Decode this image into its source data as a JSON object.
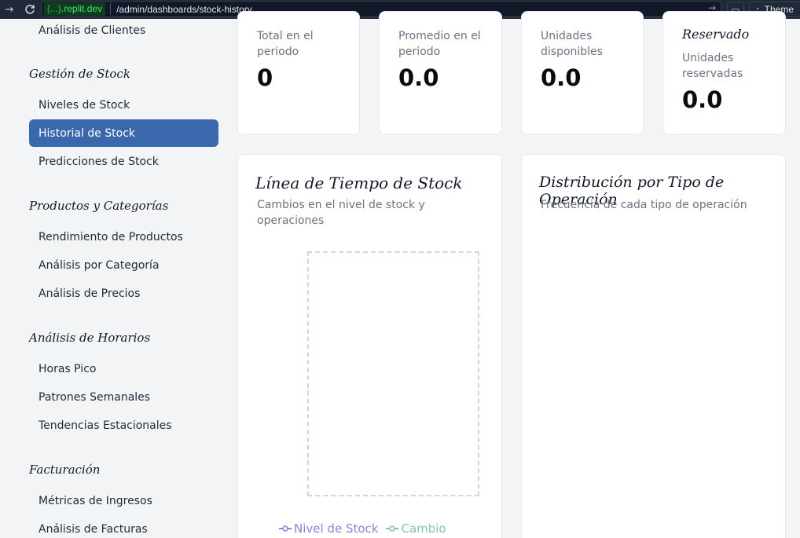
{
  "browser": {
    "domain_prefix": "{...}",
    "domain": ".replit.dev",
    "path": "/admin/dashboards/stock-history",
    "theme_label": "Theme"
  },
  "sidebar": {
    "top_item": "Análisis de Clientes",
    "sections": [
      {
        "title": "Gestión de Stock",
        "items": [
          "Niveles de Stock",
          "Historial de Stock",
          "Predicciones de Stock"
        ]
      },
      {
        "title": "Productos y Categorías",
        "items": [
          "Rendimiento de Productos",
          "Análisis por Categoría",
          "Análisis de Precios"
        ]
      },
      {
        "title": "Análisis de Horarios",
        "items": [
          "Horas Pico",
          "Patrones Semanales",
          "Tendencias Estacionales"
        ]
      },
      {
        "title": "Facturación",
        "items": [
          "Métricas de Ingresos",
          "Análisis de Facturas"
        ]
      }
    ],
    "active_item": "Historial de Stock"
  },
  "stats": {
    "total": {
      "label": "Total en el periodo",
      "value": "0"
    },
    "promedio": {
      "label": "Promedio en el periodo",
      "value": "0.0"
    },
    "disponibles": {
      "label": "Unidades disponibles",
      "value": "0.0"
    },
    "reservado": {
      "title": "Reservado",
      "label": "Unidades reservadas",
      "value": "0.0"
    }
  },
  "timeline": {
    "title": "Línea de Tiempo de Stock",
    "subtitle": "Cambios en el nivel de stock y operaciones",
    "legend": [
      {
        "label": "Nivel de Stock",
        "color": "#8884d8"
      },
      {
        "label": "Cambio",
        "color": "#82ca9d"
      }
    ]
  },
  "distribution": {
    "title": "Distribución por Tipo de Operación",
    "subtitle": "Frecuencia de cada tipo de operación"
  },
  "chart_data": {
    "type": "line",
    "title": "Línea de Tiempo de Stock",
    "x": [],
    "series": [
      {
        "name": "Nivel de Stock",
        "values": []
      },
      {
        "name": "Cambio",
        "values": []
      }
    ]
  }
}
